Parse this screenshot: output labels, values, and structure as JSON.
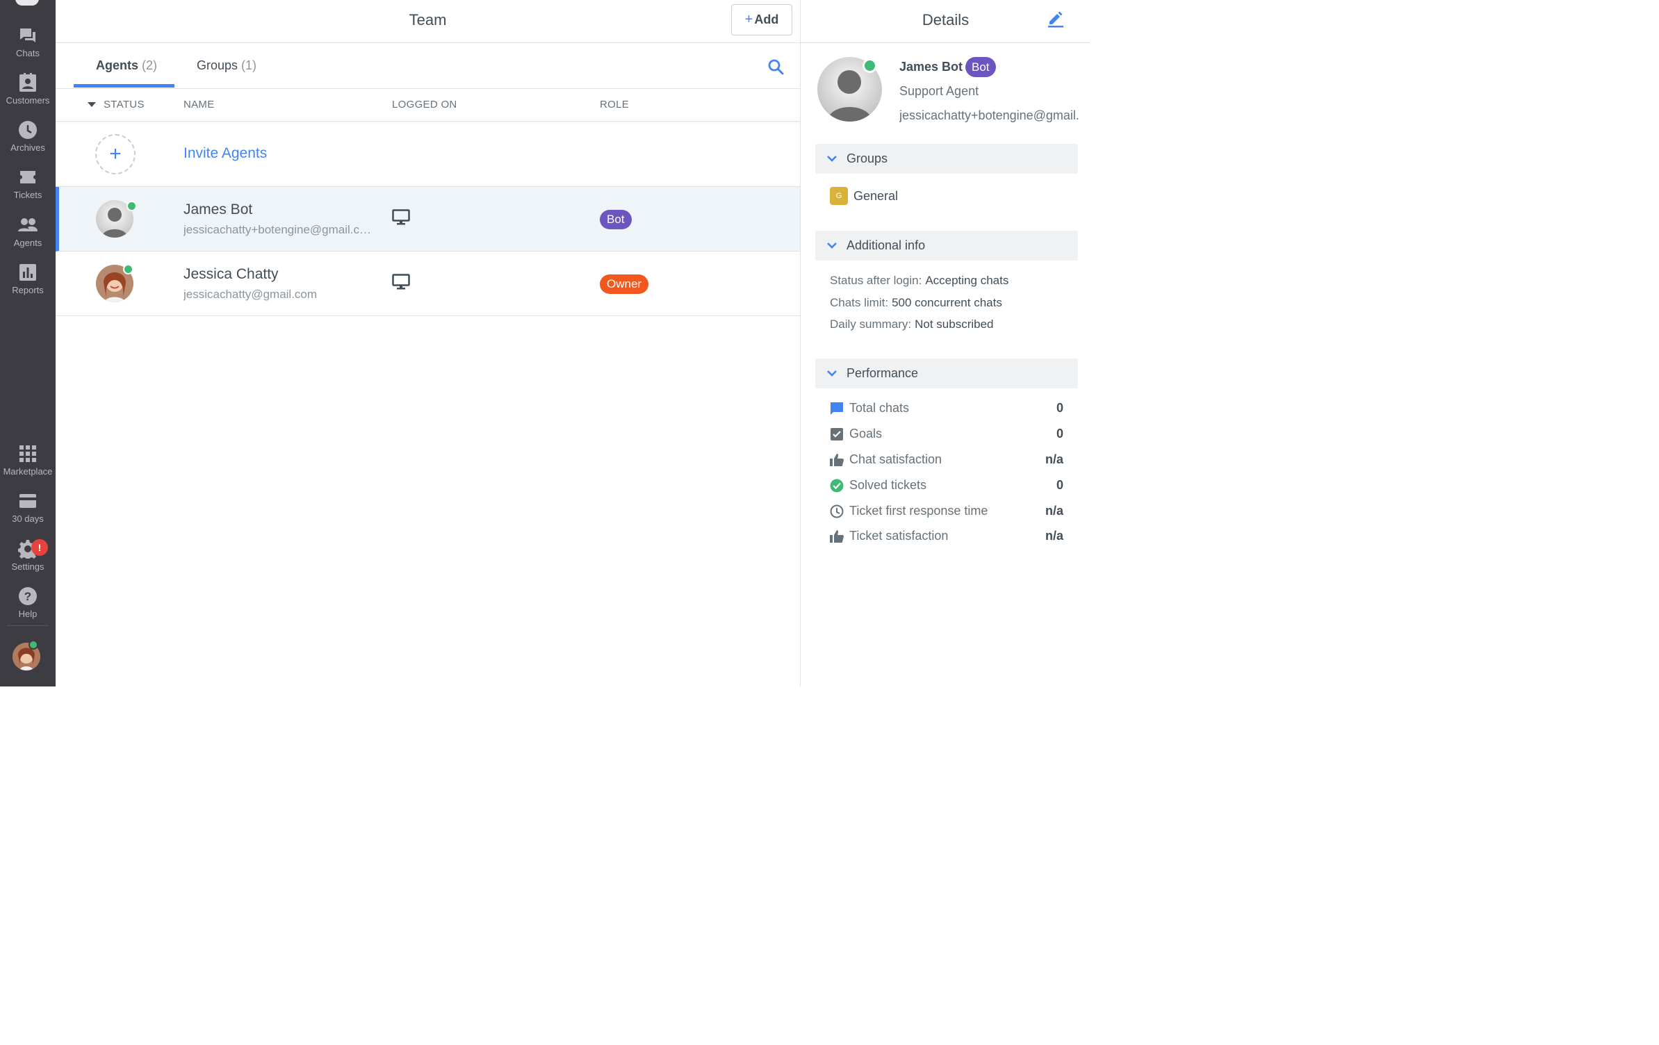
{
  "sidebar": {
    "items": [
      {
        "label": "Chats",
        "icon": "chat-bubbles-icon"
      },
      {
        "label": "Customers",
        "icon": "customer-card-icon"
      },
      {
        "label": "Archives",
        "icon": "clock-icon"
      },
      {
        "label": "Tickets",
        "icon": "ticket-icon"
      },
      {
        "label": "Agents",
        "icon": "people-icon"
      },
      {
        "label": "Reports",
        "icon": "bar-chart-icon"
      },
      {
        "label": "Marketplace",
        "icon": "grid-icon"
      },
      {
        "label": "30 days",
        "icon": "card-icon"
      },
      {
        "label": "Settings",
        "icon": "gear-icon"
      },
      {
        "label": "Help",
        "icon": "question-icon"
      }
    ],
    "settings_badge": "!"
  },
  "team": {
    "title": "Team",
    "add_plus": "+",
    "add_label": "Add",
    "tabs": [
      {
        "label": "Agents",
        "count": "(2)"
      },
      {
        "label": "Groups",
        "count": "(1)"
      }
    ],
    "columns": {
      "status": "STATUS",
      "name": "NAME",
      "logged_on": "LOGGED ON",
      "role": "ROLE"
    },
    "invite_label": "Invite Agents",
    "agents": [
      {
        "name": "James Bot",
        "email": "jessicachatty+botengine@gmail.com",
        "role": "Bot",
        "role_color": "#6c55bf"
      },
      {
        "name": "Jessica Chatty",
        "email": "jessicachatty@gmail.com",
        "role": "Owner",
        "role_color": "#f2581e"
      }
    ]
  },
  "details": {
    "title": "Details",
    "name": "James Bot",
    "badge": "Bot",
    "role": "Support Agent",
    "email": "jessicachatty+botengine@gmail.com",
    "groups_title": "Groups",
    "group": {
      "initial": "G",
      "name": "General"
    },
    "additional_title": "Additional info",
    "info": [
      {
        "key": "Status after login:",
        "value": "Accepting chats"
      },
      {
        "key": "Chats limit:",
        "value": "500 concurrent chats"
      },
      {
        "key": "Daily summary:",
        "value": "Not subscribed"
      }
    ],
    "performance_title": "Performance",
    "performance": [
      {
        "label": "Total chats",
        "value": "0",
        "icon": "chat-square-icon"
      },
      {
        "label": "Goals",
        "value": "0",
        "icon": "checkbox-icon"
      },
      {
        "label": "Chat satisfaction",
        "value": "n/a",
        "icon": "thumbs-up-icon"
      },
      {
        "label": "Solved tickets",
        "value": "0",
        "icon": "check-circle-icon"
      },
      {
        "label": "Ticket first response time",
        "value": "n/a",
        "icon": "clock-icon"
      },
      {
        "label": "Ticket satisfaction",
        "value": "n/a",
        "icon": "thumbs-up-icon"
      }
    ]
  },
  "colors": {
    "accent": "#4384f5",
    "sidebar_bg": "#3d3c43",
    "online": "#3fba74",
    "bot_badge": "#6c55bf",
    "owner_badge": "#f2581e"
  }
}
